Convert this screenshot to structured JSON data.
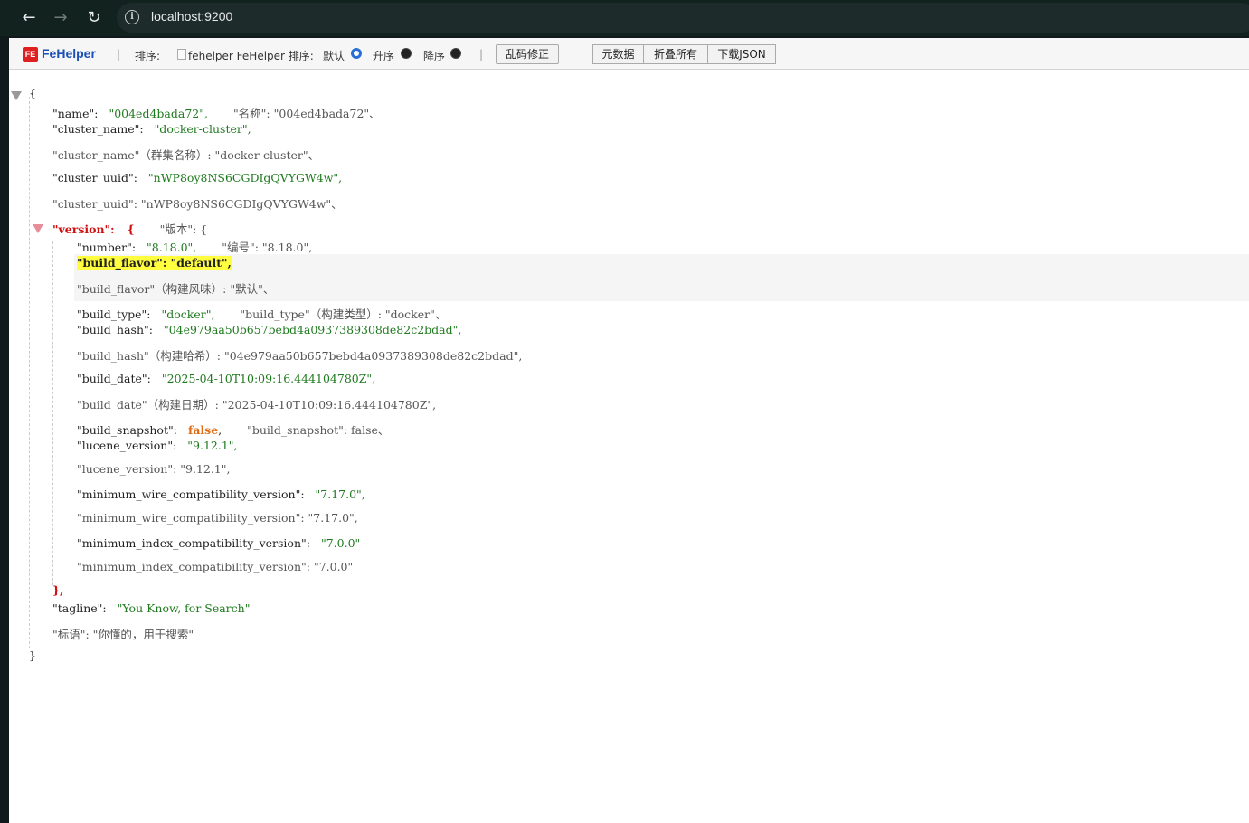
{
  "browser": {
    "url": "localhost:9200"
  },
  "toolbar": {
    "logo_box": "FE",
    "logo_text": "FeHelper",
    "separator": "|",
    "sort_label": "排序:",
    "img_alt_text": "fehelper FeHelper 排序:",
    "opt_default": "默认",
    "opt_asc": "升序",
    "opt_desc": "降序",
    "btn_fix_encoding": "乱码修正",
    "btn_metadata": "元数据",
    "btn_collapse_all": "折叠所有",
    "btn_download": "下载JSON"
  },
  "json": {
    "open_brace": "{",
    "close_brace": "}",
    "name_key": "\"name\":",
    "name_val": "\"004ed4bada72\",",
    "name_tr": "\"名称\": \"004ed4bada72\"、",
    "cluster_name_key": "\"cluster_name\":",
    "cluster_name_val": "\"docker-cluster\",",
    "cluster_name_tr": "\"cluster_name\"（群集名称）: \"docker-cluster\"、",
    "cluster_uuid_key": "\"cluster_uuid\":",
    "cluster_uuid_val": "\"nWP8oy8NS6CGDIgQVYGW4w\",",
    "cluster_uuid_tr": "\"cluster_uuid\": \"nWP8oy8NS6CGDIgQVYGW4w\"、",
    "version_key": "\"version\":",
    "version_open": "{",
    "version_tr": "\"版本\": {",
    "number_key": "\"number\":",
    "number_val": "\"8.18.0\",",
    "number_tr": "\"编号\": \"8.18.0\",",
    "build_flavor_hl": "\"build_flavor\":  \"default\",",
    "build_flavor_tr": "\"build_flavor\"（构建风味）: \"默认\"、",
    "build_type_key": "\"build_type\":",
    "build_type_val": "\"docker\",",
    "build_type_tr": "\"build_type\"（构建类型）: \"docker\"、",
    "build_hash_key": "\"build_hash\":",
    "build_hash_val": "\"04e979aa50b657bebd4a0937389308de82c2bdad\",",
    "build_hash_tr": "\"build_hash\"（构建哈希）: \"04e979aa50b657bebd4a0937389308de82c2bdad\",",
    "build_date_key": "\"build_date\":",
    "build_date_val": "\"2025-04-10T10:09:16.444104780Z\",",
    "build_date_tr": "\"build_date\"（构建日期）: \"2025-04-10T10:09:16.444104780Z\",",
    "build_snapshot_key": "\"build_snapshot\":",
    "build_snapshot_val": "false",
    "build_snapshot_comma": ",",
    "build_snapshot_tr": "\"build_snapshot\": false、",
    "lucene_version_key": "\"lucene_version\":",
    "lucene_version_val": "\"9.12.1\",",
    "lucene_version_tr": "\"lucene_version\": \"9.12.1\",",
    "mwcv_key": "\"minimum_wire_compatibility_version\":",
    "mwcv_val": "\"7.17.0\",",
    "mwcv_tr": "\"minimum_wire_compatibility_version\": \"7.17.0\",",
    "micv_key": "\"minimum_index_compatibility_version\":",
    "micv_val": "\"7.0.0\"",
    "micv_tr": "\"minimum_index_compatibility_version\": \"7.0.0\"",
    "version_close": "},",
    "tagline_key": "\"tagline\":",
    "tagline_val": "\"You Know, for Search\"",
    "tagline_tr": "\"标语\": \"你懂的，用于搜索\""
  }
}
